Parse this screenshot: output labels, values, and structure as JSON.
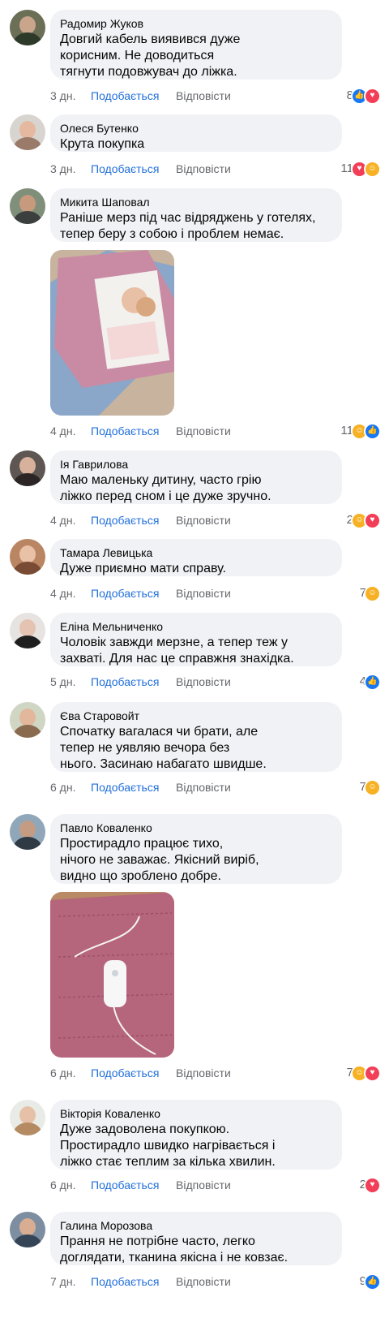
{
  "comments": [
    {
      "author": "Радомир Жуков",
      "text": "Довгий кабель виявився дуже\nкорисним. Не доводиться\nтягнути подовжувач до ліжка.",
      "time": "3 дн.",
      "like": "Подобається",
      "reply": "Відповісти",
      "reactions": "8"
    },
    {
      "author": "Олеся Бутенко",
      "text": "Крута покупка",
      "time": "3 дн.",
      "like": "Подобається",
      "reply": "Відповісти",
      "reactions": "11"
    },
    {
      "author": "Микита Шаповал",
      "text": "Раніше мерз під час відряджень у готелях,\nтепер беру з собою і проблем немає.",
      "time": "4 дн.",
      "like": "Подобається",
      "reply": "Відповісти",
      "reactions": "11"
    },
    {
      "author": "Ія Гаврилова",
      "text": "Маю маленьку дитину, часто грію\nліжко перед сном і це дуже зручно.",
      "time": "4 дн.",
      "like": "Подобається",
      "reply": "Відповісти",
      "reactions": "2"
    },
    {
      "author": "Тамара Левицька",
      "text": "Дуже приємно мати справу.",
      "time": "4 дн.",
      "like": "Подобається",
      "reply": "Відповісти",
      "reactions": "7"
    },
    {
      "author": "Еліна Мельниченко",
      "text": "Чоловік завжди мерзне, а тепер теж у\nзахваті. Для нас це справжня знахідка.",
      "time": "5 дн.",
      "like": "Подобається",
      "reply": "Відповісти",
      "reactions": "4"
    },
    {
      "author": "Єва Старовойт",
      "text": "Спочатку вагалася чи брати, але\nтепер не уявляю вечора без\nнього. Засинаю набагато швидше.",
      "time": "6 дн.",
      "like": "Подобається",
      "reply": "Відповісти",
      "reactions": "7"
    },
    {
      "author": "Павло Коваленко",
      "text": "Простирадло працює тихо,\nнічого не заважає. Якісний виріб,\nвидно що зроблено добре.",
      "time": "6 дн.",
      "like": "Подобається",
      "reply": "Відповісти",
      "reactions": "7"
    },
    {
      "author": "Вікторія Коваленко",
      "text": "Дуже задоволена покупкою.\nПростирадло швидко нагрівається і\nліжко стає теплим за кілька хвилин.",
      "time": "6 дн.",
      "like": "Подобається",
      "reply": "Відповісти",
      "reactions": "2"
    },
    {
      "author": "Галина Морозова",
      "text": "Прання не потрібне часто, легко\nдоглядати, тканина якісна і не ковзає.",
      "time": "7 дн.",
      "like": "Подобається",
      "reply": "Відповісти",
      "reactions": "9"
    }
  ],
  "colors": {
    "link": "#216fdb",
    "muted": "#65676b",
    "bubble": "#f0f2f5",
    "like": "#1877f2",
    "love": "#f33e58",
    "care": "#f7b125"
  }
}
